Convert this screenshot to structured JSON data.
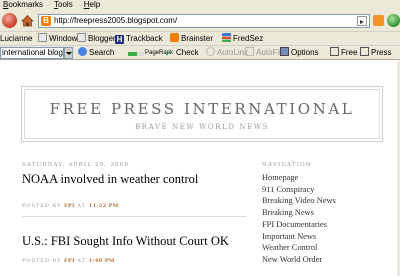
{
  "menubar": {
    "items": [
      "Bookmarks",
      "Tools",
      "Help"
    ]
  },
  "navbar": {
    "url": "http://freepress2005.blogspot.com/",
    "favicon_letter": "B"
  },
  "bookmarks": {
    "items": [
      {
        "label": "Lucianne",
        "icon": "page-icon",
        "color": "#e8e8e8"
      },
      {
        "label": "Windows",
        "icon": "page-icon",
        "color": "#e8e8e8"
      },
      {
        "label": "Blogger",
        "icon": "page-icon",
        "color": "#e8e8e8"
      },
      {
        "label": "Trackback",
        "icon": "h-icon",
        "color": "#1c2f8a"
      },
      {
        "label": "Brainster",
        "icon": "blogger-icon",
        "color": "#f57d00"
      },
      {
        "label": "FredSez",
        "icon": "bars-icon",
        "color": "#3a7bd5"
      }
    ]
  },
  "toolbar2": {
    "search_value": "international blog",
    "search_label": "Search",
    "pagerank_label": "PageRank",
    "check_label": "Check",
    "autolink_label": "AutoLink",
    "autofill_label": "AutoFill",
    "options_label": "Options",
    "free_label": "Free",
    "press_label": "Press"
  },
  "blog": {
    "title": "FREE PRESS INTERNATIONAL",
    "description": "BRAVE NEW WORLD NEWS",
    "date_header": "SATURDAY, APRIL 29, 2006",
    "posts": [
      {
        "title": "NOAA involved in weather control",
        "posted_by_label": "POSTED BY",
        "author": "FPI",
        "at_label": "AT",
        "time": "11:22 PM"
      },
      {
        "title": "U.S.: FBI Sought Info Without Court OK",
        "posted_by_label": "POSTED BY",
        "author": "FPI",
        "at_label": "AT",
        "time": "1:40 PM"
      }
    ]
  },
  "sidebar": {
    "title": "NAVIGATION",
    "items": [
      "Homepage",
      "911 Conspiracy",
      "Breaking Video News",
      "Breaking News",
      "FPI Documentaries",
      "Important News",
      "Weather Control",
      "New World Order"
    ]
  }
}
